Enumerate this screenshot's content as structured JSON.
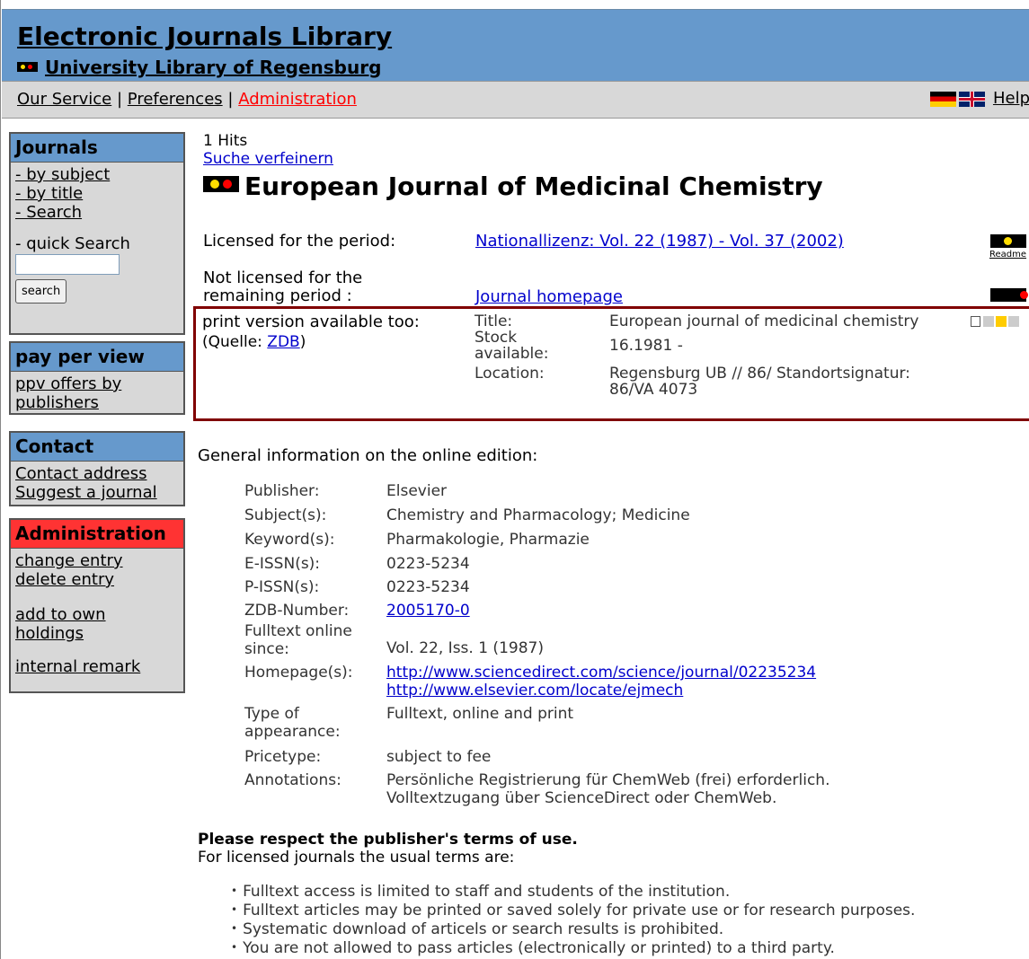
{
  "header": {
    "title": "Electronic Journals Library",
    "subtitle": "University Library of Regensburg"
  },
  "nav": {
    "links": [
      "Our Service",
      "Preferences",
      "Administration"
    ],
    "separator": "|",
    "help": "Help"
  },
  "sidebar": {
    "journals": {
      "title": "Journals",
      "items": [
        "- by subject",
        "- by title",
        "- Search"
      ],
      "quick_search_label": "- quick Search",
      "search_button": "search"
    },
    "ppv": {
      "title": "pay per view",
      "items": [
        "ppv offers by publishers"
      ]
    },
    "contact": {
      "title": "Contact",
      "items": [
        "Contact address",
        "Suggest a journal"
      ]
    },
    "admin": {
      "title": "Administration",
      "items": [
        "change entry",
        "delete entry",
        "add to own holdings",
        "internal remark"
      ]
    }
  },
  "main": {
    "hits": "1 Hits",
    "refine": "Suche verfeinern",
    "journal_title": "European Journal of Medicinal Chemistry",
    "licensed_label": "Licensed for the period:",
    "licensed_value": "Nationallizenz: Vol. 22 (1987) - Vol. 37 (2002)",
    "readme": "Readme",
    "not_licensed_label_1": "Not licensed for the",
    "not_licensed_label_2": "remaining period :",
    "not_licensed_value": "Journal homepage",
    "print": {
      "label": "print version available too:",
      "source_prefix": "(Quelle: ",
      "source_link": "ZDB",
      "source_suffix": ")",
      "title_key": "Title:",
      "title_val": "European journal of medicinal chemistry",
      "stock_key": "Stock available:",
      "stock_val": "16.1981 -",
      "location_key": "Location:",
      "location_val": "Regensburg UB // 86/ Standortsignatur: 86/VA 4073"
    },
    "general_heading": "General information on the online edition:",
    "info": {
      "publisher_k": "Publisher:",
      "publisher_v": "Elsevier",
      "subject_k": "Subject(s):",
      "subject_v": "Chemistry and Pharmacology; Medicine",
      "keyword_k": "Keyword(s):",
      "keyword_v": "Pharmakologie, Pharmazie",
      "eissn_k": "E-ISSN(s):",
      "eissn_v": "0223-5234",
      "pissn_k": "P-ISSN(s):",
      "pissn_v": "0223-5234",
      "zdb_k": "ZDB-Number:",
      "zdb_v": "2005170-0",
      "since_k": "Fulltext online since:",
      "since_v": "Vol. 22, Iss. 1 (1987)",
      "home_k": "Homepage(s):",
      "home_v1": "http://www.sciencedirect.com/science/journal/02235234",
      "home_v2": "http://www.elsevier.com/locate/ejmech",
      "type_k": "Type of appearance:",
      "type_v": "Fulltext, online and print",
      "price_k": "Pricetype:",
      "price_v": "subject to fee",
      "annot_k": "Annotations:",
      "annot_v1": "Persönliche Registrierung für ChemWeb (frei) erforderlich.",
      "annot_v2": "Volltextzugang über ScienceDirect oder ChemWeb."
    },
    "terms": {
      "heading": "Please respect the publisher's terms of use.",
      "intro": "For licensed journals the usual terms are:",
      "items": [
        "Fulltext access is limited to staff and students of the institution.",
        "Fulltext articles may be printed or saved solely for private use or for research purposes.",
        "Systematic download of articels or search results is prohibited.",
        "You are not allowed to pass articles (electronically or printed) to a third party."
      ]
    }
  },
  "colors": {
    "header_blue": "#6699cc",
    "nav_gray": "#d8d8d8",
    "admin_red": "#ff3333",
    "print_border": "#800000",
    "traffic_yellow": "#ffdd00",
    "traffic_red": "#ff0000"
  }
}
